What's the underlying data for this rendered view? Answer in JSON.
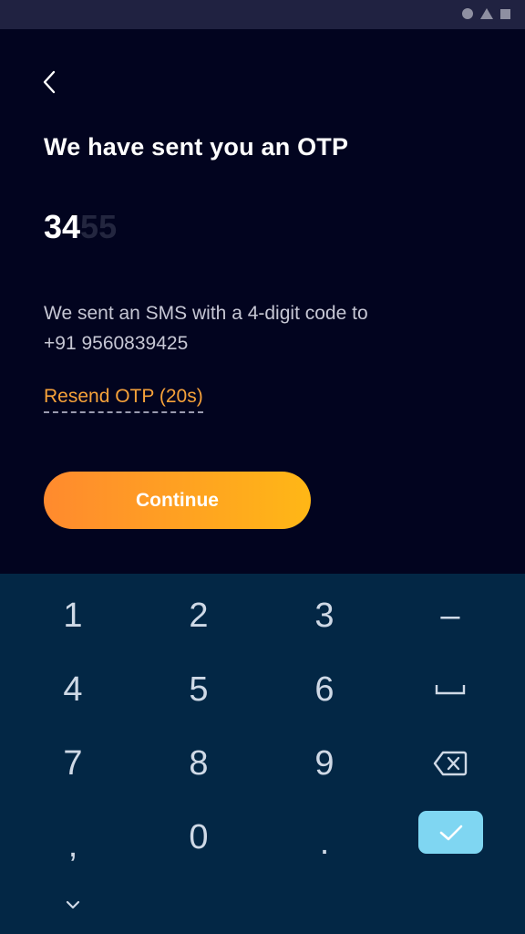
{
  "header": {
    "title": "We have sent you an OTP"
  },
  "otp": {
    "entered": "34",
    "placeholder_remaining": "55"
  },
  "message": {
    "line1": "We sent an SMS with a 4-digit code to",
    "phone": "+91 9560839425"
  },
  "resend": {
    "label": "Resend OTP (20s)"
  },
  "continue": {
    "label": "Continue"
  },
  "keypad": {
    "keys": {
      "k1": "1",
      "k2": "2",
      "k3": "3",
      "minus": "–",
      "k4": "4",
      "k5": "5",
      "k6": "6",
      "k7": "7",
      "k8": "8",
      "k9": "9",
      "comma": ",",
      "k0": "0",
      "dot": "."
    },
    "icons": {
      "space": "space-bar-icon",
      "backspace": "backspace-icon",
      "done": "checkmark-icon",
      "collapse": "chevron-down-icon"
    }
  },
  "status_bar": {
    "icons": [
      "circle-icon",
      "triangle-icon",
      "square-icon"
    ]
  },
  "colors": {
    "background": "#02041f",
    "keypad_bg": "#032745",
    "accent_orange": "#ff8a2e",
    "accent_yellow": "#ffb716",
    "resend_text": "#f7a23a",
    "done_key": "#7fd6f2"
  }
}
